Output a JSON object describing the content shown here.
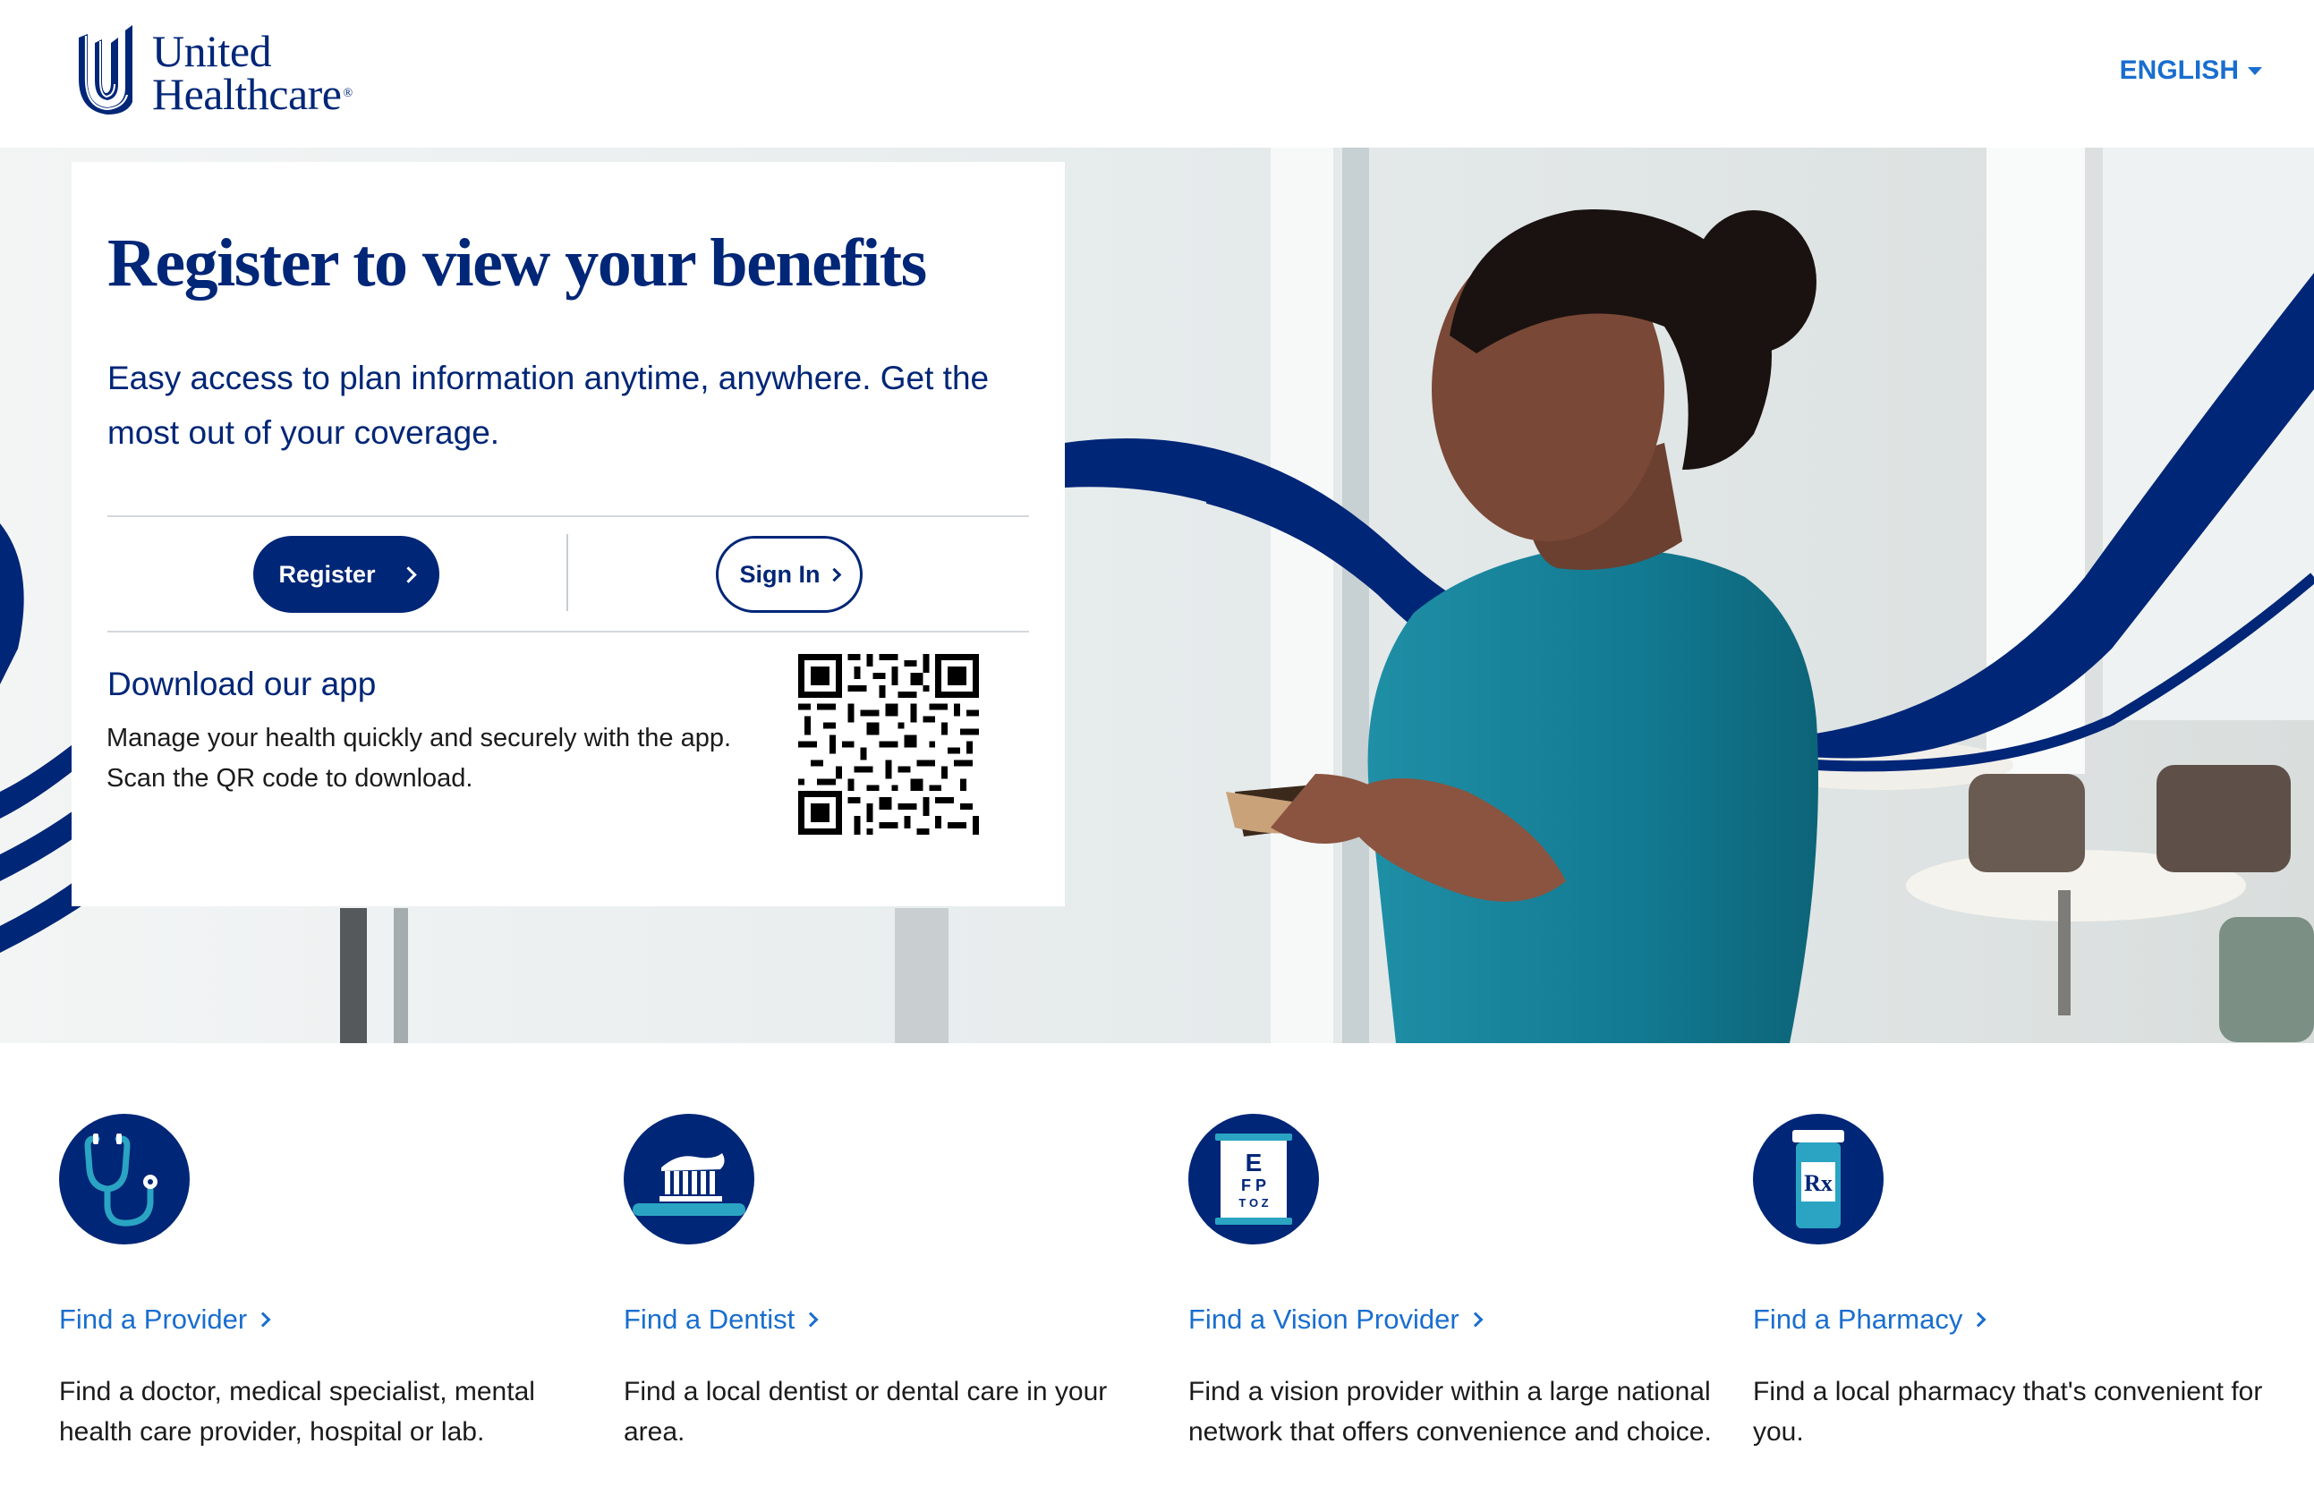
{
  "header": {
    "logo_line1": "United",
    "logo_line2": "Healthcare",
    "logo_mark": "registered",
    "language": "ENGLISH"
  },
  "hero": {
    "title": "Register to view your benefits",
    "subtitle": "Easy access to plan information anytime, anywhere. Get the most out of your coverage.",
    "register_label": "Register",
    "signin_label": "Sign In",
    "download_title": "Download our app",
    "download_text_line1": "Manage your health quickly and securely with the app.",
    "download_text_line2": "Scan the QR code to download."
  },
  "features": [
    {
      "icon": "stethoscope-icon",
      "link": "Find a Provider",
      "desc": "Find a doctor, medical specialist, mental health care provider, hospital or lab."
    },
    {
      "icon": "toothbrush-icon",
      "link": "Find a Dentist",
      "desc": "Find a local dentist or dental care in your area."
    },
    {
      "icon": "eye-chart-icon",
      "link": "Find a Vision Provider",
      "desc": "Find a vision provider within a large national network that offers convenience and choice."
    },
    {
      "icon": "pill-bottle-icon",
      "link": "Find a Pharmacy",
      "desc": "Find a local pharmacy that's convenient for you."
    }
  ],
  "eye_chart": {
    "row1": "E",
    "row2": "F P",
    "row3": "T O Z"
  },
  "rx_label": "Rx",
  "colors": {
    "brand_navy": "#002677",
    "link_blue": "#196ECF",
    "teal": "#1B9BB8",
    "text_dark": "#1b1b1b"
  }
}
